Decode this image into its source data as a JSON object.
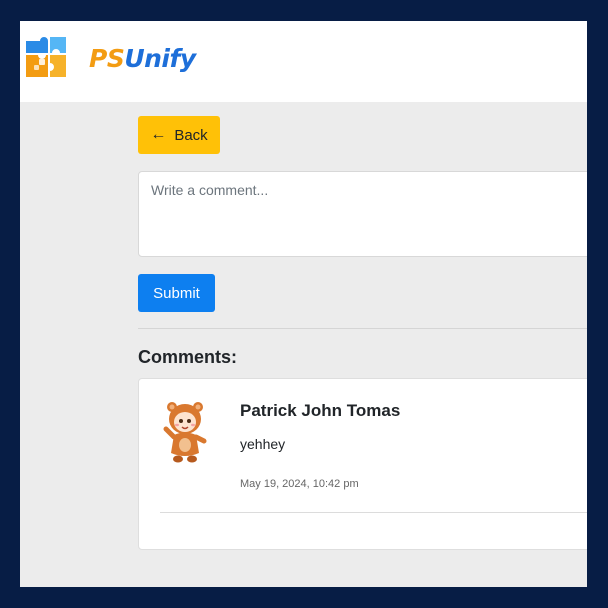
{
  "header": {
    "brand_prefix": "PS",
    "brand_suffix": "Unify",
    "logo_icon": "puzzle-logo-icon"
  },
  "back_button": {
    "label": "Back",
    "icon": "arrow-left-icon"
  },
  "comment_form": {
    "placeholder": "Write a comment...",
    "value": "",
    "submit_label": "Submit"
  },
  "comments": {
    "heading": "Comments:",
    "items": [
      {
        "author": "Patrick John Tomas",
        "text": "yehhey",
        "timestamp": "May 19, 2024, 10:42 pm",
        "avatar_icon": "avatar-icon"
      }
    ]
  },
  "colors": {
    "outer_background": "#071d45",
    "page_background": "#ececec",
    "back_button": "#ffc107",
    "submit_button": "#0d7ff0",
    "brand_orange": "#f39c12",
    "brand_blue": "#1e6fd9"
  }
}
